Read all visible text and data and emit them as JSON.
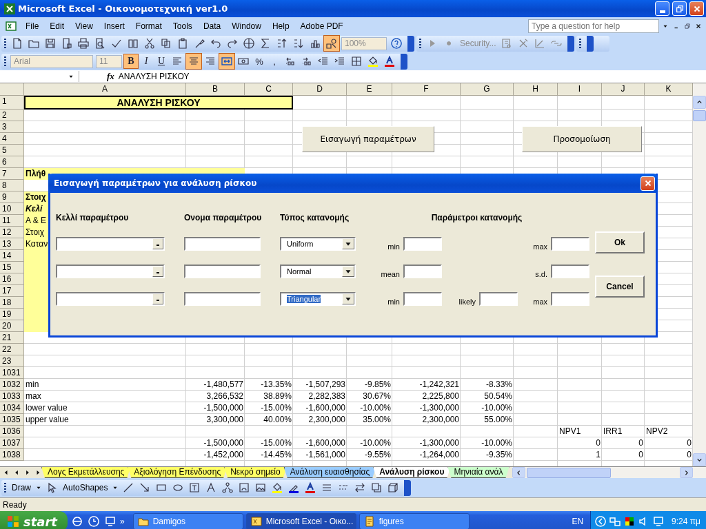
{
  "window": {
    "title": "Microsoft Excel - Οικονομοτεχνική ver1.0"
  },
  "menu": [
    "File",
    "Edit",
    "View",
    "Insert",
    "Format",
    "Tools",
    "Data",
    "Window",
    "Help",
    "Adobe PDF"
  ],
  "help_box": {
    "placeholder": "Type a question for help"
  },
  "standard_toolbar": {
    "drawing_on": true,
    "zoom": "100%"
  },
  "security_toolbar": {
    "label": "Security..."
  },
  "formatting_toolbar": {
    "font": "Arial",
    "size": "11",
    "styles": [
      {
        "label": "B",
        "on": true
      },
      {
        "label": "I",
        "on": false
      },
      {
        "label": "U",
        "on": false
      }
    ],
    "alignment": [
      {
        "on": false
      },
      {
        "on": true
      },
      {
        "on": false
      }
    ],
    "merge_on": true,
    "number_formats": [
      "%",
      ","
    ]
  },
  "formula_bar": {
    "function_label": "fx",
    "value": "ΑΝΑΛΥΣΗ ΡΙΣΚΟΥ"
  },
  "sheet": {
    "columns": [
      "A",
      "B",
      "C",
      "D",
      "E",
      "F",
      "G",
      "H",
      "I",
      "J",
      "K"
    ],
    "rows": [
      {
        "header": "1",
        "cells": {
          "A": {
            "merged": true,
            "kind": "title",
            "text": "ΑΝΑΛΥΣΗ ΡΙΣΚΟΥ",
            "fill": true
          }
        }
      },
      {
        "header": "2",
        "cells": {}
      },
      {
        "header": "3",
        "cells": {}
      },
      {
        "header": "4",
        "cells": {}
      },
      {
        "header": "5",
        "cells": {}
      },
      {
        "header": "6",
        "cells": {}
      },
      {
        "header": "7",
        "cells": {
          "A": {
            "kind": "bold",
            "text": "Πλήθ",
            "fill": true
          },
          "B": {
            "kind": "number",
            "fill": true
          }
        }
      },
      {
        "header": "8",
        "cells": {}
      },
      {
        "header": "9",
        "cells": {
          "A": {
            "kind": "bold",
            "text": "Στοιχ",
            "fill": true
          }
        }
      },
      {
        "header": "10",
        "cells": {
          "A": {
            "kind": "bold_italic",
            "text": "Κελί",
            "fill": true
          }
        }
      },
      {
        "header": "11",
        "cells": {
          "A": {
            "kind": "text",
            "text": "Α & Ε",
            "fill": true
          }
        }
      },
      {
        "header": "12",
        "cells": {
          "A": {
            "kind": "text",
            "text": "Στοιχ",
            "fill": true
          }
        }
      },
      {
        "header": "13",
        "cells": {
          "A": {
            "kind": "text",
            "text": "Καταν",
            "fill": true
          }
        }
      },
      {
        "header": "14",
        "cells": {
          "A": {
            "kind": "text",
            "fill": true
          }
        }
      },
      {
        "header": "15",
        "cells": {
          "A": {
            "kind": "text",
            "fill": true
          }
        }
      },
      {
        "header": "16",
        "cells": {
          "A": {
            "kind": "text",
            "fill": true
          }
        }
      },
      {
        "header": "17",
        "cells": {
          "A": {
            "kind": "text",
            "fill": true
          }
        }
      },
      {
        "header": "18",
        "cells": {
          "A": {
            "kind": "text",
            "fill": true
          }
        }
      },
      {
        "header": "19",
        "cells": {
          "A": {
            "kind": "text",
            "fill": true
          }
        }
      },
      {
        "header": "20",
        "cells": {
          "A": {
            "kind": "text",
            "fill": true
          }
        }
      },
      {
        "header": "21",
        "cells": {}
      },
      {
        "header": "22",
        "cells": {}
      },
      {
        "header": "23",
        "cells": {}
      },
      {
        "header": "1031",
        "cells": {}
      },
      {
        "header": "1032",
        "cells": {
          "A": {
            "kind": "text",
            "text": "min",
            "fill": false
          },
          "B": {
            "kind": "number",
            "text": "-1,480,577",
            "fill": false
          },
          "C": {
            "kind": "number",
            "text": "-13.35%",
            "fill": false
          },
          "D": {
            "kind": "number",
            "text": "-1,507,293",
            "fill": false
          },
          "E": {
            "kind": "number",
            "text": "-9.85%",
            "fill": false
          },
          "F": {
            "kind": "number",
            "text": "-1,242,321",
            "fill": false
          },
          "G": {
            "kind": "number",
            "text": "-8.33%",
            "fill": false
          }
        }
      },
      {
        "header": "1033",
        "cells": {
          "A": {
            "kind": "text",
            "text": "max",
            "fill": false
          },
          "B": {
            "kind": "number",
            "text": "3,266,532",
            "fill": false
          },
          "C": {
            "kind": "number",
            "text": "38.89%",
            "fill": false
          },
          "D": {
            "kind": "number",
            "text": "2,282,383",
            "fill": false
          },
          "E": {
            "kind": "number",
            "text": "30.67%",
            "fill": false
          },
          "F": {
            "kind": "number",
            "text": "2,225,800",
            "fill": false
          },
          "G": {
            "kind": "number",
            "text": "50.54%",
            "fill": false
          }
        }
      },
      {
        "header": "1034",
        "cells": {
          "A": {
            "kind": "text",
            "text": "lower value",
            "fill": false
          },
          "B": {
            "kind": "number",
            "text": "-1,500,000",
            "fill": false
          },
          "C": {
            "kind": "number",
            "text": "-15.00%",
            "fill": false
          },
          "D": {
            "kind": "number",
            "text": "-1,600,000",
            "fill": false
          },
          "E": {
            "kind": "number",
            "text": "-10.00%",
            "fill": false
          },
          "F": {
            "kind": "number",
            "text": "-1,300,000",
            "fill": false
          },
          "G": {
            "kind": "number",
            "text": "-10.00%",
            "fill": false
          }
        }
      },
      {
        "header": "1035",
        "cells": {
          "A": {
            "kind": "text",
            "text": "upper value",
            "fill": false
          },
          "B": {
            "kind": "number",
            "text": "3,300,000",
            "fill": false
          },
          "C": {
            "kind": "number",
            "text": "40.00%",
            "fill": false
          },
          "D": {
            "kind": "number",
            "text": "2,300,000",
            "fill": false
          },
          "E": {
            "kind": "number",
            "text": "35.00%",
            "fill": false
          },
          "F": {
            "kind": "number",
            "text": "2,300,000",
            "fill": false
          },
          "G": {
            "kind": "number",
            "text": "55.00%",
            "fill": false
          }
        }
      },
      {
        "header": "1036",
        "cells": {
          "I": {
            "kind": "text",
            "text": "NPV1",
            "fill": false
          },
          "J": {
            "kind": "text",
            "text": "IRR1",
            "fill": false
          },
          "K": {
            "kind": "text",
            "text": "NPV2",
            "fill": false
          }
        }
      },
      {
        "header": "1037",
        "cells": {
          "B": {
            "kind": "number",
            "text": "-1,500,000",
            "fill": false
          },
          "C": {
            "kind": "number",
            "text": "-15.00%",
            "fill": false
          },
          "D": {
            "kind": "number",
            "text": "-1,600,000",
            "fill": false
          },
          "E": {
            "kind": "number",
            "text": "-10.00%",
            "fill": false
          },
          "F": {
            "kind": "number",
            "text": "-1,300,000",
            "fill": false
          },
          "G": {
            "kind": "number",
            "text": "-10.00%",
            "fill": false
          },
          "I": {
            "kind": "number",
            "text": "0",
            "fill": false
          },
          "J": {
            "kind": "number",
            "text": "0",
            "fill": false
          },
          "K": {
            "kind": "number",
            "text": "0",
            "fill": false
          }
        }
      },
      {
        "header": "1038",
        "cells": {
          "B": {
            "kind": "number",
            "text": "-1,452,000",
            "fill": false
          },
          "C": {
            "kind": "number",
            "text": "-14.45%",
            "fill": false
          },
          "D": {
            "kind": "number",
            "text": "-1,561,000",
            "fill": false
          },
          "E": {
            "kind": "number",
            "text": "-9.55%",
            "fill": false
          },
          "F": {
            "kind": "number",
            "text": "-1,264,000",
            "fill": false
          },
          "G": {
            "kind": "number",
            "text": "-9.35%",
            "fill": false
          },
          "I": {
            "kind": "number",
            "text": "1",
            "fill": false
          },
          "J": {
            "kind": "number",
            "text": "0",
            "fill": false
          },
          "K": {
            "kind": "number",
            "text": "0",
            "fill": false
          }
        }
      }
    ],
    "buttons": [
      "Εισαγωγή παραμέτρων",
      "Προσομοίωση"
    ]
  },
  "dialog": {
    "title": "Εισαγωγή παραμέτρων για ανάλυση ρίσκου",
    "headers": [
      "Κελλί παραμέτρου",
      "Ονομα παραμέτρου",
      "Τύπος κατανομής",
      "Παράμετροι κατανομής"
    ],
    "rows": [
      {
        "distribution": "Uniform",
        "text_selected": false,
        "params": [
          {
            "label": "min",
            "kind": "first"
          },
          {
            "label": "max",
            "kind": "third"
          }
        ]
      },
      {
        "distribution": "Normal",
        "text_selected": false,
        "params": [
          {
            "label": "mean",
            "kind": "first"
          },
          {
            "label": "s.d.",
            "kind": "third"
          }
        ]
      },
      {
        "distribution": "Triangular",
        "text_selected": true,
        "params": [
          {
            "label": "min",
            "kind": "first"
          },
          {
            "label": "likely",
            "kind": "second"
          },
          {
            "label": "max",
            "kind": "third"
          }
        ]
      }
    ],
    "buttons": [
      "Ok",
      "Cancel"
    ]
  },
  "sheet_tabs": [
    {
      "label": "Λογς Εκμετάλλευσης",
      "selected": false,
      "color": "#ffff66"
    },
    {
      "label": "Αξιολόγηση Επένδυσης",
      "selected": false,
      "color": "#ffff66"
    },
    {
      "label": "Νεκρό σημείο",
      "selected": false,
      "color": "#ffff66"
    },
    {
      "label": "Ανάλυση ευαισθησίας",
      "selected": false,
      "color": "#99ccff"
    },
    {
      "label": "Ανάλυση ρίσκου",
      "selected": true
    },
    {
      "label": "Μηνιαία ανάλ",
      "selected": false,
      "color": "#ccffcc"
    }
  ],
  "drawing_toolbar": {
    "menus": [
      "Draw",
      "AutoShapes"
    ]
  },
  "status_bar": {
    "text": "Ready"
  },
  "taskbar": {
    "start": "start",
    "more": "»",
    "tasks": [
      {
        "label": "Damigos",
        "selected": false,
        "kind": "folder"
      },
      {
        "label": "Microsoft Excel - Οικο...",
        "selected": true,
        "kind": "excel"
      },
      {
        "label": "figures",
        "selected": false,
        "kind": "document"
      }
    ],
    "language": "EN",
    "clock": "9:24 πμ"
  }
}
